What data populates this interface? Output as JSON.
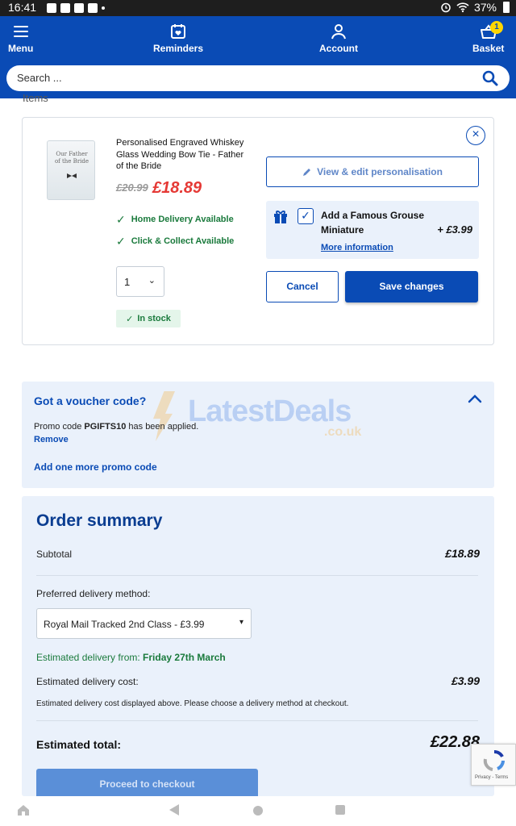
{
  "status_bar": {
    "time": "16:41",
    "battery": "37%"
  },
  "header": {
    "nav": [
      {
        "label": "Menu",
        "icon": "menu-icon"
      },
      {
        "label": "Reminders",
        "icon": "calendar-heart-icon"
      },
      {
        "label": "Account",
        "icon": "person-icon"
      },
      {
        "label": "Basket",
        "icon": "basket-icon",
        "badge": "1"
      }
    ],
    "search_placeholder": "Search ...",
    "brand_color": "#0a4bb5"
  },
  "items_heading": "Items",
  "item": {
    "title": "Personalised Engraved Whiskey Glass Wedding Bow Tie - Father of the Bride",
    "thumb_text": "Our Father of the Bride",
    "price_old": "£20.99",
    "price_new": "£18.89",
    "availability": [
      "Home Delivery Available",
      "Click & Collect Available"
    ],
    "quantity": "1",
    "stock": "In stock",
    "view_edit_label": "View & edit personalisation",
    "gift": {
      "label": "Add a Famous Grouse Miniature",
      "price": "+ £3.99",
      "more_info": "More information",
      "checked": true
    },
    "cancel_label": "Cancel",
    "save_label": "Save changes"
  },
  "voucher": {
    "title": "Got a voucher code?",
    "promo_prefix": "Promo code ",
    "promo_code": "PGIFTS10",
    "promo_suffix": " has been applied.",
    "remove": "Remove",
    "add_more": "Add one more promo code",
    "watermark_main": "LatestDeals",
    "watermark_sub": ".co.uk"
  },
  "summary": {
    "title": "Order summary",
    "subtotal_label": "Subtotal",
    "subtotal_value": "£18.89",
    "delivery_method_label": "Preferred delivery method:",
    "delivery_method_value": "Royal Mail Tracked 2nd Class - £3.99",
    "est_delivery_label": "Estimated delivery from: ",
    "est_delivery_date": "Friday 27th March",
    "est_cost_label": "Estimated delivery cost:",
    "est_cost_value": "£3.99",
    "note": "Estimated delivery cost displayed above. Please choose a delivery method at checkout.",
    "total_label": "Estimated total:",
    "total_value": "£22.88",
    "checkout_label": "Proceed to checkout"
  },
  "recaptcha_text": "Privacy - Terms"
}
